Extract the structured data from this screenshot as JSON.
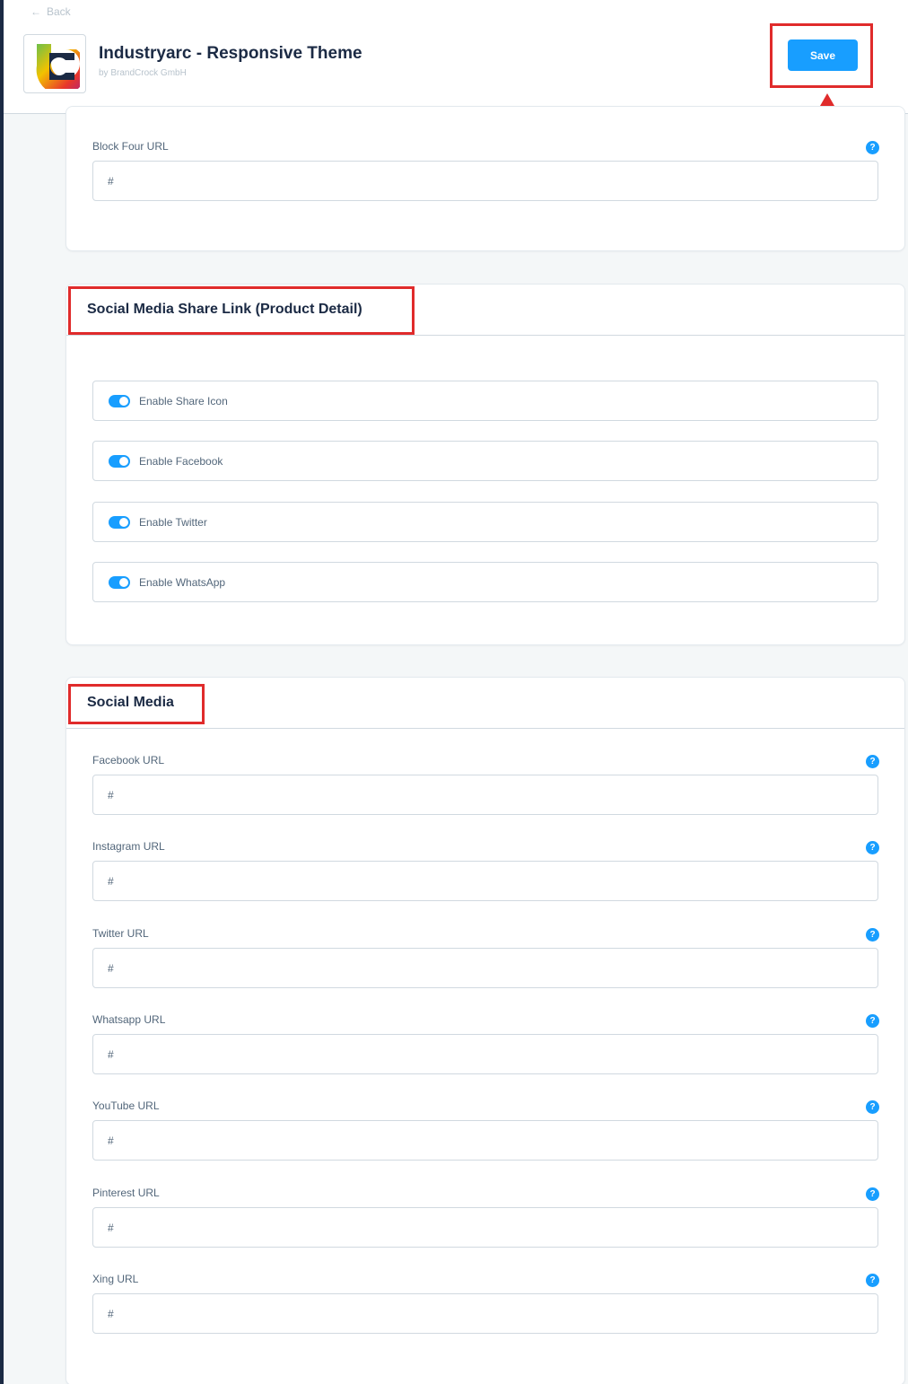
{
  "header": {
    "back_label": "Back",
    "app_title": "Industryarc - Responsive Theme",
    "app_vendor": "by BrandCrock GmbH",
    "save_label": "Save"
  },
  "block_four": {
    "label": "Block Four URL",
    "value": "#"
  },
  "share_links": {
    "title": "Social Media Share Link (Product Detail)",
    "toggles": [
      {
        "label": "Enable Share Icon",
        "enabled": true
      },
      {
        "label": "Enable Facebook",
        "enabled": true
      },
      {
        "label": "Enable Twitter",
        "enabled": true
      },
      {
        "label": "Enable WhatsApp",
        "enabled": true
      }
    ]
  },
  "social_media": {
    "title": "Social Media",
    "fields": [
      {
        "label": "Facebook URL",
        "value": "#"
      },
      {
        "label": "Instagram URL",
        "value": "#"
      },
      {
        "label": "Twitter URL",
        "value": "#"
      },
      {
        "label": "Whatsapp URL",
        "value": "#"
      },
      {
        "label": "YouTube URL",
        "value": "#"
      },
      {
        "label": "Pinterest URL",
        "value": "#"
      },
      {
        "label": "Xing URL",
        "value": "#"
      }
    ]
  },
  "help_glyph": "?",
  "colors": {
    "accent": "#189eff",
    "annotation": "#e02b2b",
    "sidebar": "#1b2a44"
  }
}
